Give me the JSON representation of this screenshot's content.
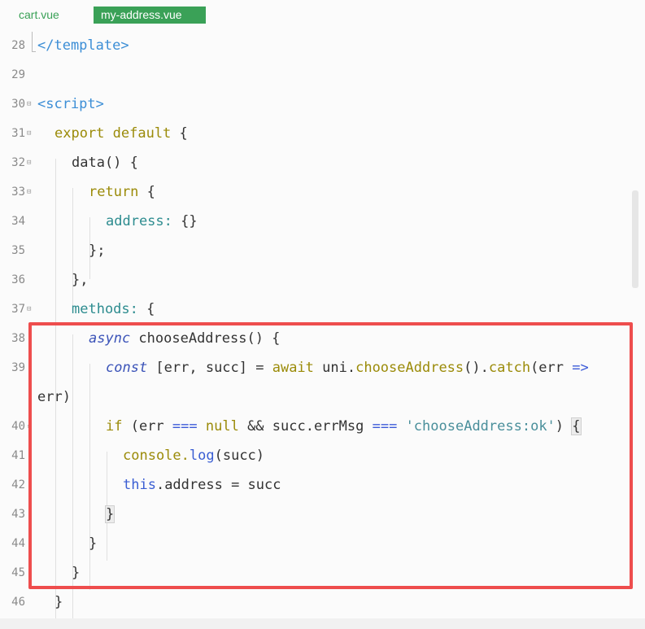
{
  "tabs": [
    {
      "label": "cart.vue"
    },
    {
      "label": "my-address.vue"
    }
  ],
  "lines": {
    "l28": {
      "num": "28",
      "text": "</template>"
    },
    "l29": {
      "num": "29"
    },
    "l30": {
      "num": "30",
      "text": "<script>"
    },
    "l31": {
      "num": "31",
      "kw": "export default",
      "rest": " {"
    },
    "l32": {
      "num": "32",
      "text": "data() {"
    },
    "l33": {
      "num": "33",
      "kw": "return",
      "rest": " {"
    },
    "l34": {
      "num": "34",
      "prop": "address:",
      "rest": " {}"
    },
    "l35": {
      "num": "35",
      "text": "};"
    },
    "l36": {
      "num": "36",
      "text": "},"
    },
    "l37": {
      "num": "37",
      "prop": "methods:",
      "rest": " {"
    },
    "l38": {
      "num": "38",
      "kw": "async",
      "rest": " chooseAddress() {"
    },
    "l39": {
      "num": "39",
      "kw": "const",
      "a": " [err, succ] = ",
      "await": "await",
      "b": " uni.",
      "fn1": "chooseAddress",
      "c": "().",
      "fn2": "catch",
      "d": "(err ",
      "arrow": "=>"
    },
    "l39b": {
      "text": "err)"
    },
    "l40": {
      "num": "40",
      "kw": "if",
      "a": " (err ",
      "op1": "===",
      "b": " ",
      "null": "null",
      "c": " && succ.errMsg ",
      "op2": "===",
      "d": " ",
      "str": "'chooseAddress:ok'",
      "e": ") ",
      "brace": "{"
    },
    "l41": {
      "num": "41",
      "a": "console.",
      "fn": "log",
      "b": "(succ)"
    },
    "l42": {
      "num": "42",
      "this": "this",
      "b": ".address = succ"
    },
    "l43": {
      "num": "43",
      "brace": "}"
    },
    "l44": {
      "num": "44",
      "text": "}"
    },
    "l45": {
      "num": "45",
      "text": "}"
    },
    "l46": {
      "num": "46",
      "text": "}"
    }
  }
}
